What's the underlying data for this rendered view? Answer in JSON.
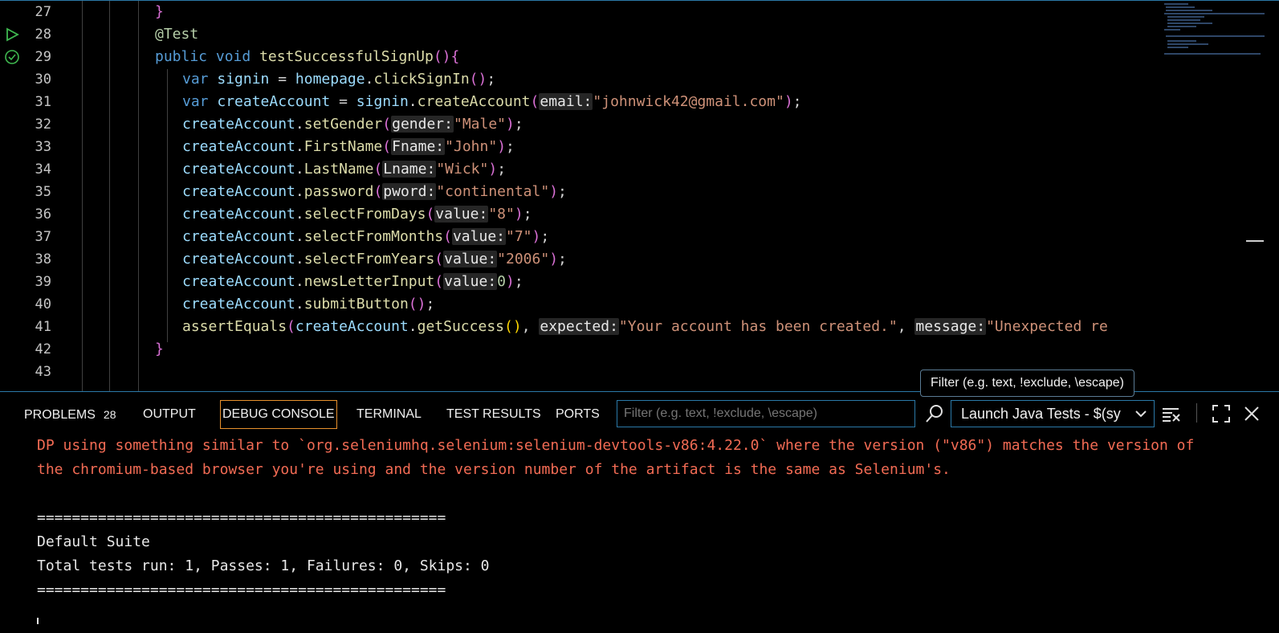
{
  "editor": {
    "lines": [
      {
        "num": "27",
        "indent": 2,
        "tokens": [
          {
            "t": "}",
            "c": "br"
          }
        ]
      },
      {
        "num": "28",
        "indent": 2,
        "gutter": "run",
        "tokens": [
          {
            "t": "@Test",
            "c": "ann"
          }
        ]
      },
      {
        "num": "29",
        "indent": 2,
        "gutter": "passed",
        "tokens": [
          {
            "t": "public",
            "c": "kw"
          },
          {
            "t": " "
          },
          {
            "t": "void",
            "c": "kw"
          },
          {
            "t": " "
          },
          {
            "t": "testSuccessfulSignUp",
            "c": "fn"
          },
          {
            "t": "()",
            "c": "br"
          },
          {
            "t": "{",
            "c": "br"
          }
        ]
      },
      {
        "num": "30",
        "indent": 3,
        "tokens": [
          {
            "t": "var",
            "c": "kw"
          },
          {
            "t": " "
          },
          {
            "t": "signin",
            "c": "vr"
          },
          {
            "t": " = "
          },
          {
            "t": "homepage",
            "c": "vr"
          },
          {
            "t": "."
          },
          {
            "t": "clickSignIn",
            "c": "fn"
          },
          {
            "t": "()",
            "c": "br"
          },
          {
            "t": ";"
          }
        ]
      },
      {
        "num": "31",
        "indent": 3,
        "tokens": [
          {
            "t": "var",
            "c": "kw"
          },
          {
            "t": " "
          },
          {
            "t": "createAccount",
            "c": "vr"
          },
          {
            "t": " = "
          },
          {
            "t": "signin",
            "c": "vr"
          },
          {
            "t": "."
          },
          {
            "t": "createAccount",
            "c": "fn"
          },
          {
            "t": "(",
            "c": "br"
          },
          {
            "t": "email:",
            "c": "hint"
          },
          {
            "t": "\"johnwick42@gmail.com\"",
            "c": "st"
          },
          {
            "t": ")",
            "c": "br"
          },
          {
            "t": ";"
          }
        ]
      },
      {
        "num": "32",
        "indent": 3,
        "tokens": [
          {
            "t": "createAccount",
            "c": "vr"
          },
          {
            "t": "."
          },
          {
            "t": "setGender",
            "c": "fn"
          },
          {
            "t": "(",
            "c": "br"
          },
          {
            "t": "gender:",
            "c": "hint"
          },
          {
            "t": "\"Male\"",
            "c": "st"
          },
          {
            "t": ")",
            "c": "br"
          },
          {
            "t": ";"
          }
        ]
      },
      {
        "num": "33",
        "indent": 3,
        "tokens": [
          {
            "t": "createAccount",
            "c": "vr"
          },
          {
            "t": "."
          },
          {
            "t": "FirstName",
            "c": "fn"
          },
          {
            "t": "(",
            "c": "br"
          },
          {
            "t": "Fname:",
            "c": "hint"
          },
          {
            "t": "\"John\"",
            "c": "st"
          },
          {
            "t": ")",
            "c": "br"
          },
          {
            "t": ";"
          }
        ]
      },
      {
        "num": "34",
        "indent": 3,
        "tokens": [
          {
            "t": "createAccount",
            "c": "vr"
          },
          {
            "t": "."
          },
          {
            "t": "LastName",
            "c": "fn"
          },
          {
            "t": "(",
            "c": "br"
          },
          {
            "t": "Lname:",
            "c": "hint"
          },
          {
            "t": "\"Wick\"",
            "c": "st"
          },
          {
            "t": ")",
            "c": "br"
          },
          {
            "t": ";"
          }
        ]
      },
      {
        "num": "35",
        "indent": 3,
        "tokens": [
          {
            "t": "createAccount",
            "c": "vr"
          },
          {
            "t": "."
          },
          {
            "t": "password",
            "c": "fn"
          },
          {
            "t": "(",
            "c": "br"
          },
          {
            "t": "pword:",
            "c": "hint"
          },
          {
            "t": "\"continental\"",
            "c": "st"
          },
          {
            "t": ")",
            "c": "br"
          },
          {
            "t": ";"
          }
        ]
      },
      {
        "num": "36",
        "indent": 3,
        "tokens": [
          {
            "t": "createAccount",
            "c": "vr"
          },
          {
            "t": "."
          },
          {
            "t": "selectFromDays",
            "c": "fn"
          },
          {
            "t": "(",
            "c": "br"
          },
          {
            "t": "value:",
            "c": "hint"
          },
          {
            "t": "\"8\"",
            "c": "st"
          },
          {
            "t": ")",
            "c": "br"
          },
          {
            "t": ";"
          }
        ]
      },
      {
        "num": "37",
        "indent": 3,
        "tokens": [
          {
            "t": "createAccount",
            "c": "vr"
          },
          {
            "t": "."
          },
          {
            "t": "selectFromMonths",
            "c": "fn"
          },
          {
            "t": "(",
            "c": "br"
          },
          {
            "t": "value:",
            "c": "hint"
          },
          {
            "t": "\"7\"",
            "c": "st"
          },
          {
            "t": ")",
            "c": "br"
          },
          {
            "t": ";"
          }
        ]
      },
      {
        "num": "38",
        "indent": 3,
        "tokens": [
          {
            "t": "createAccount",
            "c": "vr"
          },
          {
            "t": "."
          },
          {
            "t": "selectFromYears",
            "c": "fn"
          },
          {
            "t": "(",
            "c": "br"
          },
          {
            "t": "value:",
            "c": "hint"
          },
          {
            "t": "\"2006\"",
            "c": "st"
          },
          {
            "t": ")",
            "c": "br"
          },
          {
            "t": ";"
          }
        ]
      },
      {
        "num": "39",
        "indent": 3,
        "tokens": [
          {
            "t": "createAccount",
            "c": "vr"
          },
          {
            "t": "."
          },
          {
            "t": "newsLetterInput",
            "c": "fn"
          },
          {
            "t": "(",
            "c": "br"
          },
          {
            "t": "value:",
            "c": "hint"
          },
          {
            "t": "0",
            "c": "nu"
          },
          {
            "t": ")",
            "c": "br"
          },
          {
            "t": ";"
          }
        ]
      },
      {
        "num": "40",
        "indent": 3,
        "tokens": [
          {
            "t": "createAccount",
            "c": "vr"
          },
          {
            "t": "."
          },
          {
            "t": "submitButton",
            "c": "fn"
          },
          {
            "t": "()",
            "c": "br"
          },
          {
            "t": ";"
          }
        ]
      },
      {
        "num": "41",
        "indent": 3,
        "tokens": [
          {
            "t": "assertEquals",
            "c": "fn"
          },
          {
            "t": "(",
            "c": "br"
          },
          {
            "t": "createAccount",
            "c": "vr"
          },
          {
            "t": "."
          },
          {
            "t": "getSuccess",
            "c": "fn"
          },
          {
            "t": "()",
            "c": "br2"
          },
          {
            "t": ", "
          },
          {
            "t": "expected:",
            "c": "hint"
          },
          {
            "t": "\"Your account has been created.\"",
            "c": "st"
          },
          {
            "t": ", "
          },
          {
            "t": "message:",
            "c": "hint"
          },
          {
            "t": "\"Unexpected re",
            "c": "st"
          }
        ]
      },
      {
        "num": "42",
        "indent": 2,
        "tokens": [
          {
            "t": "}",
            "c": "br"
          }
        ]
      },
      {
        "num": "43",
        "indent": 2,
        "tokens": []
      }
    ]
  },
  "panel": {
    "tabs": [
      {
        "id": "problems",
        "label": "PROBLEMS",
        "badge": "28"
      },
      {
        "id": "output",
        "label": "OUTPUT"
      },
      {
        "id": "debug-console",
        "label": "DEBUG CONSOLE",
        "active": true
      },
      {
        "id": "terminal",
        "label": "TERMINAL"
      },
      {
        "id": "test-results",
        "label": "TEST RESULTS"
      },
      {
        "id": "ports",
        "label": "PORTS"
      }
    ],
    "filter_placeholder": "Filter (e.g. text, !exclude, \\escape)",
    "filter_tooltip": "Filter (e.g. text, !exclude, \\escape)",
    "launch_config": "Launch Java Tests - $(sy",
    "icons": [
      "search-icon",
      "clear-console-icon",
      "maximize-icon",
      "close-icon"
    ]
  },
  "console": {
    "lines": [
      {
        "text": "DP using something similar to `org.seleniumhq.selenium:selenium-devtools-v86:4.22.0` where the version (\"v86\") matches the version of",
        "kind": "err"
      },
      {
        "text": "the chromium-based browser you're using and the version number of the artifact is the same as Selenium's.",
        "kind": "err"
      },
      {
        "text": "",
        "kind": "out"
      },
      {
        "text": "===============================================",
        "kind": "out"
      },
      {
        "text": "Default Suite",
        "kind": "out"
      },
      {
        "text": "Total tests run: 1, Passes: 1, Failures: 0, Skips: 0",
        "kind": "out"
      },
      {
        "text": "===============================================",
        "kind": "out"
      }
    ]
  },
  "colors": {
    "accent_border": "#2b79a8",
    "active_tab_border": "#e8912d",
    "error_text": "#f26b54",
    "run_icon": "#3fb950",
    "passed_icon": "#3fb950"
  }
}
